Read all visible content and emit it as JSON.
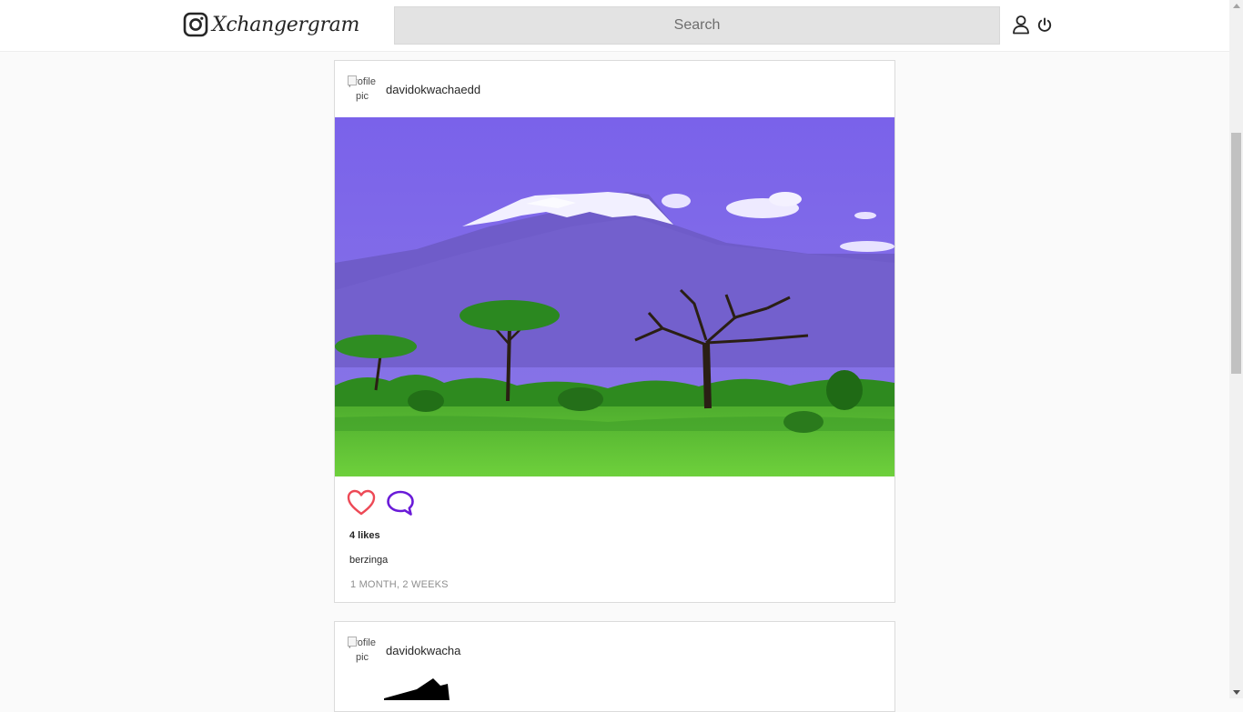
{
  "header": {
    "app_name": "Xchangergram",
    "search_placeholder": "Search",
    "icons": [
      "camera-logo-icon",
      "user-icon",
      "power-icon"
    ]
  },
  "feed": {
    "posts": [
      {
        "avatar_alt": "profile pic",
        "username": "davidokwachaedd",
        "image_alt": "Mount Kilimanjaro with acacia trees",
        "likes_text": "4 likes",
        "caption": "berzinga",
        "timestamp": "1 MONTH, 2 WEEKS"
      },
      {
        "avatar_alt": "profile pic",
        "username": "davidokwacha"
      }
    ]
  },
  "colors": {
    "heart": "#ed4956",
    "comment": "#6a1bd8",
    "search_bg": "#e3e3e3",
    "page_bg": "#fafafa"
  }
}
